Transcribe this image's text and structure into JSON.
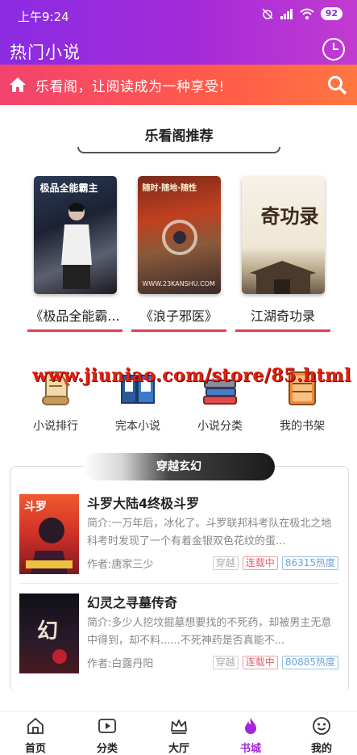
{
  "status_bar": {
    "time": "上午9:24",
    "battery": "92"
  },
  "header": {
    "title": "热门小说"
  },
  "banner": {
    "text": "乐看阁，让阅读成为一种享受!"
  },
  "recommend": {
    "title": "乐看阁推荐",
    "books": [
      {
        "title": "《极品全能霸...",
        "cover_text": "极品全能霸主"
      },
      {
        "title": "《浪子邪医》",
        "cover_text": "随时·随地·随性",
        "cover_watermark": "WWW.23KANSHU.COM"
      },
      {
        "title": "江湖奇功录",
        "cover_text": "奇功录"
      }
    ]
  },
  "watermark_text": "www.jiuniao.com/store/85.html",
  "categories": [
    {
      "label": "小说排行",
      "icon": "scroll-quill-icon"
    },
    {
      "label": "完本小说",
      "icon": "books-icon"
    },
    {
      "label": "小说分类",
      "icon": "book-stack-icon"
    },
    {
      "label": "我的书架",
      "icon": "bookshelf-icon"
    }
  ],
  "section": {
    "title": "穿越玄幻",
    "items": [
      {
        "name": "斗罗大陆4终极斗罗",
        "desc": "简介:一万年后，冰化了。斗罗联邦科考队在极北之地科考时发现了一个有着金银双色花纹的蛋...",
        "author": "作者:唐家三少",
        "tags": [
          "穿越",
          "连载中",
          "86315热度"
        ]
      },
      {
        "name": "幻灵之寻墓传奇",
        "desc": "简介:多少人挖坟掘墓想要找的不死药，却被男主无意中得到，却不料......不死神药是否真能不...",
        "author": "作者:白露丹阳",
        "tags": [
          "穿越",
          "连载中",
          "80885热度"
        ]
      }
    ]
  },
  "tabbar": {
    "tabs": [
      {
        "label": "首页",
        "icon": "home-icon"
      },
      {
        "label": "分类",
        "icon": "video-icon"
      },
      {
        "label": "大厅",
        "icon": "crown-icon"
      },
      {
        "label": "书城",
        "icon": "flame-icon",
        "active": true
      },
      {
        "label": "我的",
        "icon": "smile-icon"
      }
    ]
  },
  "colors": {
    "accent": "#a428d8",
    "banner": "#f2426e",
    "underline": "#e04050"
  }
}
